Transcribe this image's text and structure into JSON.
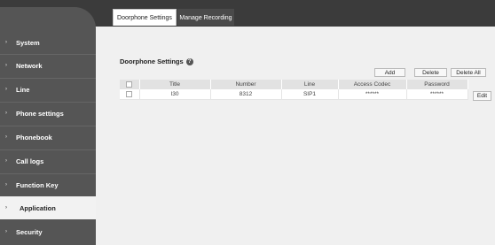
{
  "sidebar": {
    "items": [
      {
        "label": "System"
      },
      {
        "label": "Network"
      },
      {
        "label": "Line"
      },
      {
        "label": "Phone settings"
      },
      {
        "label": "Phonebook"
      },
      {
        "label": "Call logs"
      },
      {
        "label": "Function Key"
      },
      {
        "label": "Application"
      },
      {
        "label": "Security"
      }
    ],
    "active": "Application"
  },
  "tabs": [
    {
      "label": "Doorphone Settings"
    },
    {
      "label": "Manage Recording"
    }
  ],
  "section": {
    "title": "Doorphone Settings",
    "help_icon": "?"
  },
  "toolbar": {
    "add_label": "Add",
    "delete_label": "Delete",
    "delete_all_label": "Delete All"
  },
  "table": {
    "headers": [
      "Title",
      "Number",
      "Line",
      "Access Codec",
      "Password"
    ],
    "rows": [
      {
        "title": "I30",
        "number": "8312",
        "line": "SIP1",
        "access_codec": "******",
        "password": "******",
        "edit_label": "Edit"
      }
    ]
  },
  "colors": {
    "topbar": "#3b3b3b",
    "sidebar": "#555555",
    "active_item_bg": "#f2f2f2",
    "main_bg": "#f0f0f0"
  }
}
